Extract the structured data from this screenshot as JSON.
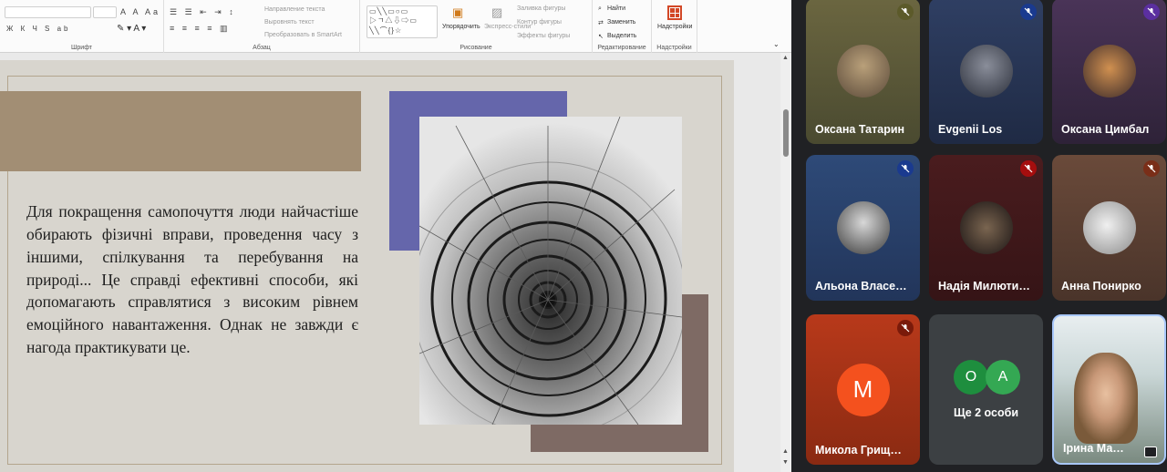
{
  "ribbon": {
    "groups": {
      "font": "Шрифт",
      "paragraph": "Абзац",
      "drawing": "Рисование",
      "editing": "Редактирование",
      "addins": "Надстройки"
    },
    "text_direction": "Направление текста",
    "align_text": "Выровнять текст",
    "smartart": "Преобразовать в SmartArt",
    "arrange": "Упорядочить",
    "quick_styles": "Экспресс-стили",
    "shape_fill": "Заливка фигуры",
    "shape_outline": "Контур фигуры",
    "shape_effects": "Эффекты фигуры",
    "find": "Найти",
    "replace": "Заменить",
    "select": "Выделить",
    "addins_button": "Надстройки",
    "font_format_symbols": "Ж К Ч S ab",
    "font_size_symbols": "A A Aa"
  },
  "slide": {
    "body_text": "Для покращення самопочуття люди найчастіше обирають фізичні вправи, проведення часу з іншими, спілкування та перебування на природі... Це справді ефективні способи, які допомагають справлятися з високим рівнем емоційного навантаження. Однак не завжди є нагода практикувати це."
  },
  "meet": {
    "participants": [
      {
        "name": "Оксана Татарин",
        "muted": true
      },
      {
        "name": "Evgenii Los",
        "muted": true
      },
      {
        "name": "Оксана Цимбал",
        "muted": true
      },
      {
        "name": "Альона Власе…",
        "muted": true
      },
      {
        "name": "Надія Милюти…",
        "muted": true
      },
      {
        "name": "Анна Понирко",
        "muted": true
      },
      {
        "name": "Микола Грищ…",
        "muted": true,
        "initial": "M"
      },
      {
        "name": "Ірина Ма…",
        "muted": false
      }
    ],
    "others": {
      "label": "Ще 2 особи",
      "initials": [
        "O",
        "A"
      ],
      "colors": [
        "#1e8e3e",
        "#34a853"
      ]
    },
    "colors": {
      "mute_red": "#a50e0e",
      "mute_blue": "#1a3a8f",
      "mute_purple": "#5b2fa0",
      "active_border": "#a8c7fa",
      "avatar_orange": "#f4511e"
    }
  }
}
